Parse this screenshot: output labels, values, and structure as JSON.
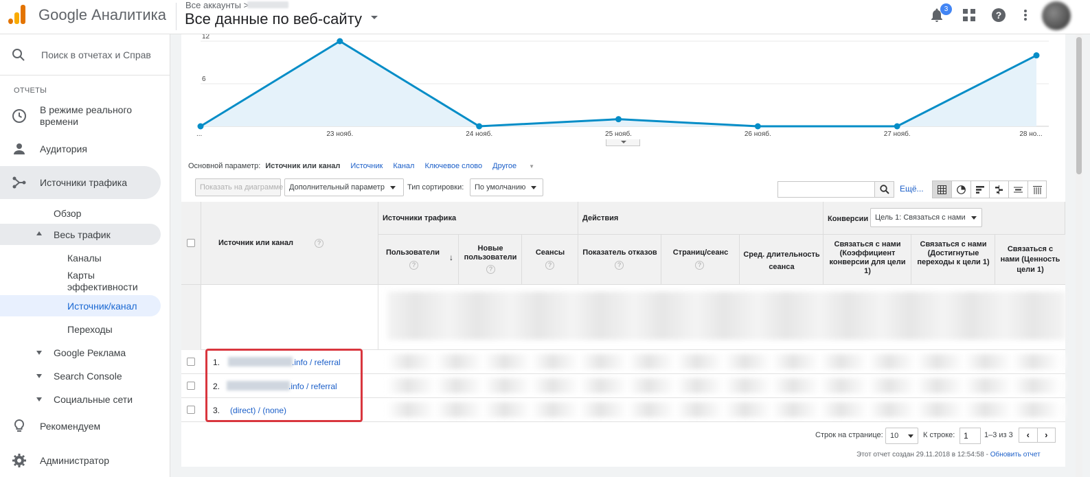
{
  "header": {
    "brand": "Google Аналитика",
    "breadcrumb": "Все аккаунты >",
    "view_title": "Все данные по веб-сайту",
    "notifications_count": "3",
    "colors": {
      "brand_orange": "#f9ab00",
      "brand_dark_orange": "#e37400"
    }
  },
  "sidebar": {
    "search_placeholder": "Поиск в отчетах и Справк",
    "section_label": "ОТЧЕТЫ",
    "realtime": "В режиме реального времени",
    "realtime_line1": "В режиме реального",
    "realtime_line2": "времени",
    "audience": "Аудитория",
    "acquisition": "Источники трафика",
    "overview": "Обзор",
    "all_traffic": "Весь трафик",
    "channels": "Каналы",
    "treemaps_line1": "Карты",
    "treemaps_line2": "эффективности",
    "source_medium": "Источник/канал",
    "referrals": "Переходы",
    "google_ads": "Google Реклама",
    "search_console": "Search Console",
    "social": "Социальные сети",
    "discover": "Рекомендуем",
    "admin": "Администратор"
  },
  "chart_data": {
    "type": "area",
    "x": [
      "...",
      "23 нояб.",
      "24 нояб.",
      "25 нояб.",
      "26 нояб.",
      "27 нояб.",
      "28 но..."
    ],
    "series": [
      {
        "values": [
          0,
          12,
          0,
          1,
          0,
          0,
          10
        ]
      }
    ],
    "yticks": [
      "6",
      "12"
    ],
    "ylim": [
      0,
      12
    ],
    "grid": true,
    "color": "#058dc7",
    "fill": "#e5f2fa"
  },
  "dimensions": {
    "label": "Основной параметр:",
    "active": "Источник или канал",
    "options": [
      "Источник",
      "Канал",
      "Ключевое слово"
    ],
    "other": "Другое"
  },
  "toolbar": {
    "plot_rows": "Показать на диаграмме",
    "secondary_dim": "Дополнительный параметр",
    "sort_label": "Тип сортировки:",
    "sort_value": "По умолчанию",
    "more": "Ещё...",
    "search_value": ""
  },
  "table": {
    "source_header": "Источник или канал",
    "group_acquisition": "Источники трафика",
    "group_behavior": "Действия",
    "group_conversions": "Конверсии",
    "goal_select": "Цель 1: Связаться с нами",
    "col_users": "Пользователи",
    "col_new_users": "Новые пользователи",
    "col_sessions": "Сеансы",
    "col_bounce": "Показатель отказов",
    "col_pages": "Страниц/сеанс",
    "col_duration": "Сред. длительность сеанса",
    "col_conv_rate": "Связаться с нами (Коэффициент конверсии для цели 1)",
    "col_completions": "Связаться с нами (Достигнутые переходы к цели 1)",
    "col_value": "Связаться с нами (Ценность цели 1)",
    "rows": [
      {
        "num": "1.",
        "source": ".info / referral"
      },
      {
        "num": "2.",
        "source": ".info / referral"
      },
      {
        "num": "3.",
        "source": "(direct) / (none)"
      }
    ]
  },
  "pagination": {
    "rows_label": "Строк на странице:",
    "rows_value": "10",
    "goto_label": "К строке:",
    "goto_value": "1",
    "range": "1–3 из 3"
  },
  "report_footer": {
    "created": "Этот отчет создан 29.11.2018 в 12:54:58 -",
    "refresh": "Обновить отчет"
  }
}
